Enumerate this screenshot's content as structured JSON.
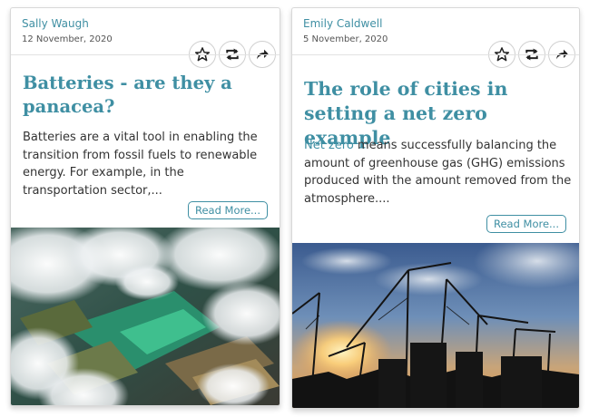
{
  "cards": [
    {
      "author": "Sally Waugh",
      "date": "12 November, 2020",
      "title": "Batteries - are they a panacea?",
      "excerpt": "Batteries are a vital tool in enabling the transition from fossil fuels to renewable energy. For example, in the transportation sector,...",
      "read_more": "Read More...",
      "actions": [
        "star-icon",
        "retweet-icon",
        "share-icon"
      ],
      "image": "aerial-clouds-solar-farm"
    },
    {
      "author": "Emily Caldwell",
      "date": "5 November, 2020",
      "title": "The role of cities in setting a net zero example",
      "excerpt_link": "Net zero",
      "excerpt_rest": " means successfully balancing the amount of greenhouse gas (GHG) emissions produced with the amount removed from the atmosphere....",
      "read_more": "Read More...",
      "actions": [
        "star-icon",
        "retweet-icon",
        "share-icon"
      ],
      "image": "construction-cranes-sunset"
    }
  ],
  "colors": {
    "accent": "#3f8fa3",
    "text": "#333333",
    "border": "#d8d8d8"
  }
}
